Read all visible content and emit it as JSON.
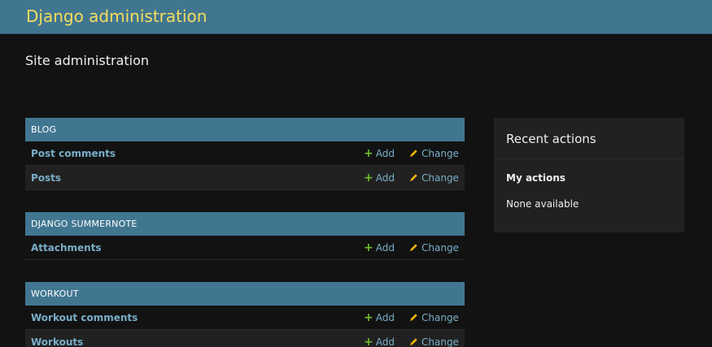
{
  "header": {
    "branding": "Django administration"
  },
  "page": {
    "title": "Site administration"
  },
  "apps": [
    {
      "caption": "BLOG",
      "models": [
        {
          "name": "Post comments",
          "add": "Add",
          "change": "Change"
        },
        {
          "name": "Posts",
          "add": "Add",
          "change": "Change"
        }
      ]
    },
    {
      "caption": "DJANGO SUMMERNOTE",
      "models": [
        {
          "name": "Attachments",
          "add": "Add",
          "change": "Change"
        }
      ]
    },
    {
      "caption": "WORKOUT",
      "models": [
        {
          "name": "Workout comments",
          "add": "Add",
          "change": "Change"
        },
        {
          "name": "Workouts",
          "add": "Add",
          "change": "Change"
        }
      ]
    }
  ],
  "recent_actions": {
    "title": "Recent actions",
    "subtitle": "My actions",
    "empty_text": "None available"
  },
  "colors": {
    "header_bg": "#417690",
    "branding": "#f5dd5d",
    "link": "#79aec8",
    "add_icon": "#70bf2b",
    "change_icon": "#efb80b",
    "page_bg": "#121212"
  },
  "icons": {
    "add": "plus-icon",
    "change": "pencil-icon"
  }
}
